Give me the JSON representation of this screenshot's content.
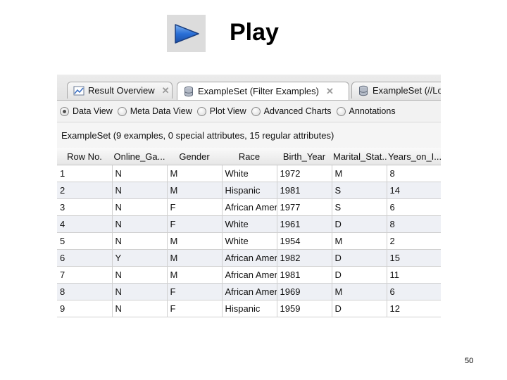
{
  "slide": {
    "title": "Play",
    "page_number": "50",
    "icon": "play-button-icon",
    "icon_color": "#2a6fd6"
  },
  "tabs": [
    {
      "label": "Result Overview",
      "icon": "result-overview-icon",
      "active": false
    },
    {
      "label": "ExampleSet (Filter Examples)",
      "icon": "database-icon",
      "active": true
    },
    {
      "label": "ExampleSet (//Loc",
      "icon": "database-icon",
      "active": false
    }
  ],
  "views": [
    {
      "label": "Data View",
      "selected": true
    },
    {
      "label": "Meta Data View",
      "selected": false
    },
    {
      "label": "Plot View",
      "selected": false
    },
    {
      "label": "Advanced Charts",
      "selected": false
    },
    {
      "label": "Annotations",
      "selected": false
    }
  ],
  "summary": "ExampleSet (9 examples, 0 special attributes, 15 regular attributes)",
  "table": {
    "columns": [
      "Row No.",
      "Online_Ga...",
      "Gender",
      "Race",
      "Birth_Year",
      "Marital_Stat...",
      "Years_on_I..."
    ],
    "rows": [
      [
        "1",
        "N",
        "M",
        "White",
        "1972",
        "M",
        "8"
      ],
      [
        "2",
        "N",
        "M",
        "Hispanic",
        "1981",
        "S",
        "14"
      ],
      [
        "3",
        "N",
        "F",
        "African Amer",
        "1977",
        "S",
        "6"
      ],
      [
        "4",
        "N",
        "F",
        "White",
        "1961",
        "D",
        "8"
      ],
      [
        "5",
        "N",
        "M",
        "White",
        "1954",
        "M",
        "2"
      ],
      [
        "6",
        "Y",
        "M",
        "African Amer",
        "1982",
        "D",
        "15"
      ],
      [
        "7",
        "N",
        "M",
        "African Amer",
        "1981",
        "D",
        "11"
      ],
      [
        "8",
        "N",
        "F",
        "African Amer",
        "1969",
        "M",
        "6"
      ],
      [
        "9",
        "N",
        "F",
        "Hispanic",
        "1959",
        "D",
        "12"
      ]
    ]
  }
}
